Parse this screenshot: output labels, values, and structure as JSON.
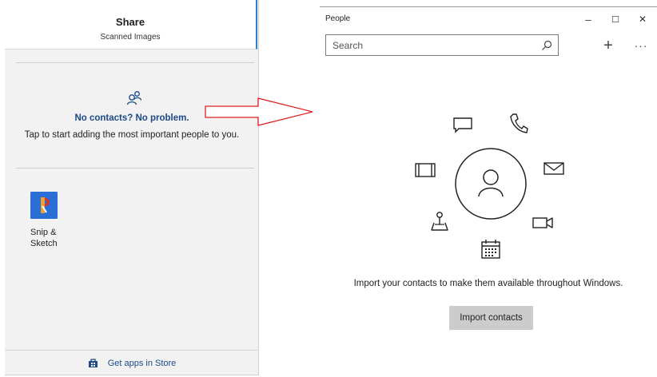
{
  "share": {
    "title": "Share",
    "subtitle": "Scanned Images",
    "no_contacts": "No contacts? No problem.",
    "tap_text": "Tap to start adding the most important people to you.",
    "app": {
      "label": "Snip &\nSketch",
      "icon": "snip-sketch-icon"
    },
    "store_link": "Get apps in Store",
    "accent": "#2f7fd0",
    "link_color": "#1a4a8a"
  },
  "arrow": {
    "color": "#e02020",
    "icon": "arrow-right-outline"
  },
  "people": {
    "window_title": "People",
    "controls": {
      "minimize": "–",
      "maximize": "☐",
      "close": "✕"
    },
    "search": {
      "placeholder": "Search",
      "value": ""
    },
    "toolbar": {
      "add": "+",
      "more": "···"
    },
    "illustration_icons": [
      "chat-icon",
      "phone-icon",
      "mail-icon",
      "video-icon",
      "calendar-icon",
      "map-pin-icon",
      "film-icon",
      "contact-icon"
    ],
    "import_text": "Import your contacts to make them available throughout Windows.",
    "import_button": "Import contacts",
    "button_color": "#cccccc"
  }
}
